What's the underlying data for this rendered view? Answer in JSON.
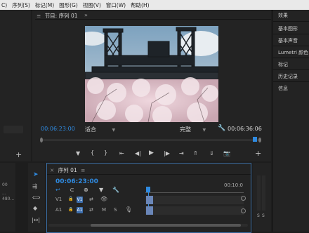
{
  "menu": {
    "items": [
      "C)",
      "序列(S)",
      "标记(M)",
      "图形(G)",
      "视图(V)",
      "窗口(W)",
      "帮助(H)"
    ]
  },
  "program_monitor": {
    "tab_label": "节目: 序列 01",
    "menu_glyph": "≡",
    "timecode": "00:06:23:00",
    "fit_select": "适合",
    "quality_select": "完整",
    "duration": "00:06:36:06"
  },
  "left_panel": {
    "ghost_button": "",
    "bottom_labels": [
      "00",
      "...",
      "480..."
    ]
  },
  "right_panel": {
    "items": [
      "效果",
      "基本图形",
      "基本声音",
      "Lumetri 颜色",
      "标记",
      "历史记录",
      "信息"
    ]
  },
  "timeline": {
    "tab_label": "序列 01",
    "menu_glyph": "≡",
    "timecode": "00:06:23:00",
    "ruler_label": "00:10:0",
    "tracks": {
      "video": {
        "name": "V1",
        "target": "V1"
      },
      "audio": {
        "name": "A1",
        "target": "A1",
        "mute": "M",
        "solo": "S"
      }
    }
  },
  "meters": {
    "labels": [
      "S",
      "S"
    ]
  },
  "colors": {
    "accent": "#2f8ae0",
    "panel": "#232323",
    "background": "#1d1d1d"
  }
}
